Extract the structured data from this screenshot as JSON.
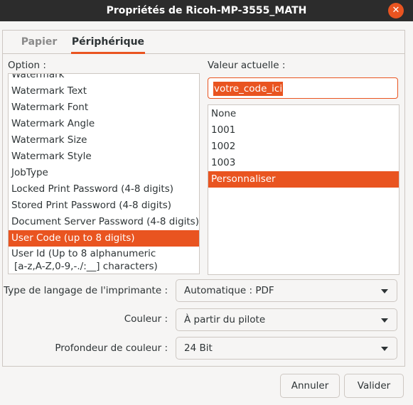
{
  "window": {
    "title": "Propriétés de Ricoh-MP-3555_MATH",
    "close_glyph": "✕"
  },
  "tabs": [
    {
      "label": "Papier",
      "active": false
    },
    {
      "label": "Périphérique",
      "active": true
    }
  ],
  "options": {
    "label": "Option :",
    "partial_top_item": "Watermark",
    "items": [
      "Watermark Text",
      "Watermark Font",
      "Watermark Angle",
      "Watermark Size",
      "Watermark Style",
      "JobType",
      "Locked Print Password (4-8 digits)",
      "Stored Print Password (4-8 digits)",
      "Document Server Password (4-8 digits)",
      "User Code (up to 8 digits)"
    ],
    "selected": "User Code (up to 8 digits)",
    "last_item_line1": "User Id (Up to 8 alphanumeric",
    "last_item_line2": "[a-z,A-Z,0-9,-./:__] characters)"
  },
  "current_value": {
    "label": "Valeur actuelle :",
    "entry_value": "votre_code_ici",
    "choices": [
      "None",
      "1001",
      "1002",
      "1003",
      "Personnaliser"
    ],
    "selected": "Personnaliser"
  },
  "settings": {
    "printer_language": {
      "label": "Type de langage de l'imprimante :",
      "value": "Automatique : PDF"
    },
    "color": {
      "label": "Couleur :",
      "value": "À partir du pilote"
    },
    "color_depth": {
      "label": "Profondeur de couleur :",
      "value": "24 Bit"
    }
  },
  "buttons": {
    "cancel": "Annuler",
    "ok": "Valider"
  },
  "colors": {
    "accent": "#e95420",
    "titlebar": "#2c2c2c",
    "window_bg": "#f6f5f4"
  }
}
